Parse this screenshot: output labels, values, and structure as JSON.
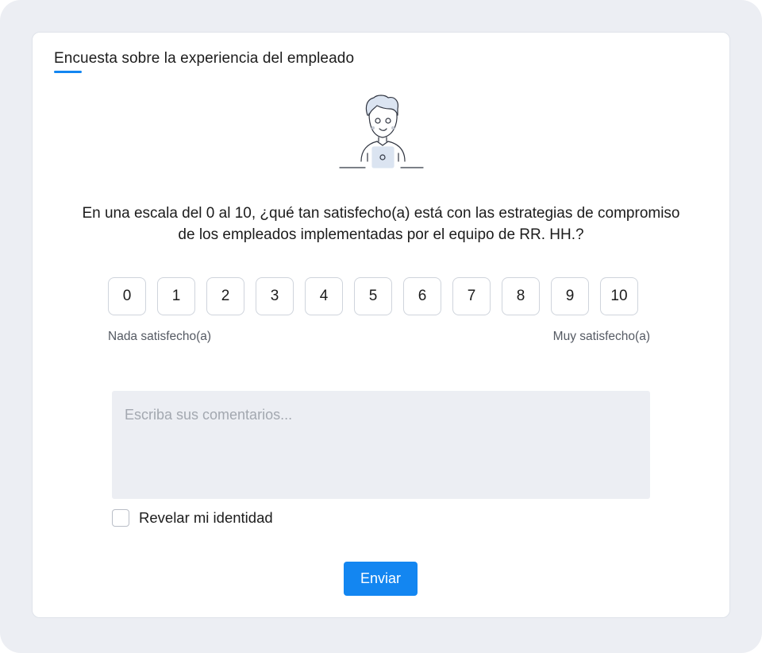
{
  "survey": {
    "title": "Encuesta sobre la experiencia del empleado",
    "illustration_icon": "person-with-laptop-icon",
    "question": "En una escala del 0 al 10, ¿qué tan satisfecho(a) está con las estrategias de compromiso de los empleados implementadas por el equipo de RR. HH.?",
    "scale": {
      "options": [
        "0",
        "1",
        "2",
        "3",
        "4",
        "5",
        "6",
        "7",
        "8",
        "9",
        "10"
      ],
      "low_label": "Nada satisfecho(a)",
      "high_label": "Muy satisfecho(a)"
    },
    "comments": {
      "placeholder": "Escriba sus comentarios...",
      "value": ""
    },
    "reveal_identity": {
      "label": "Revelar mi identidad",
      "checked": false
    },
    "submit_label": "Enviar"
  },
  "colors": {
    "accent": "#1386f1",
    "background": "#eceef3",
    "text": "#1c1c1c",
    "muted_text": "#555a63"
  }
}
